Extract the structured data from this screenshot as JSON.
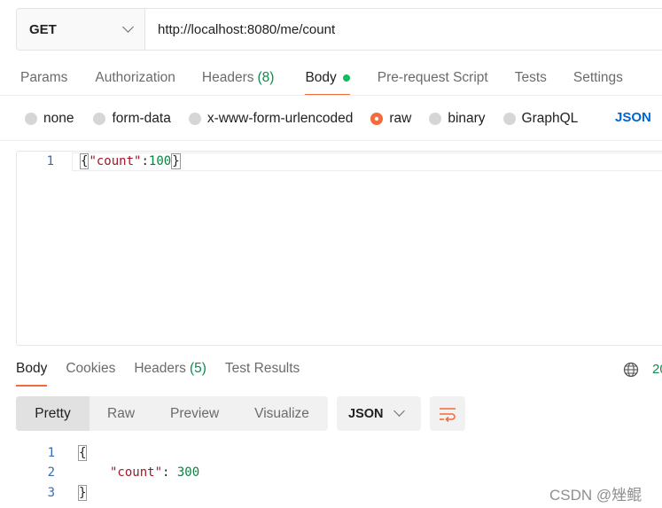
{
  "request": {
    "method": "GET",
    "url": "http://localhost:8080/me/count"
  },
  "request_tabs": [
    {
      "label": "Params"
    },
    {
      "label": "Authorization"
    },
    {
      "label": "Headers",
      "count": "(8)"
    },
    {
      "label": "Body",
      "active": true
    },
    {
      "label": "Pre-request Script"
    },
    {
      "label": "Tests"
    },
    {
      "label": "Settings"
    }
  ],
  "body_types": [
    "none",
    "form-data",
    "x-www-form-urlencoded",
    "raw",
    "binary",
    "GraphQL"
  ],
  "body_selected": "raw",
  "body_format": "JSON",
  "request_body": {
    "line": "1",
    "open_brace": "{",
    "key": "\"count\"",
    "colon": ":",
    "value": "100",
    "close_brace": "}"
  },
  "response_tabs": [
    {
      "label": "Body",
      "active": true
    },
    {
      "label": "Cookies"
    },
    {
      "label": "Headers",
      "count": "(5)"
    },
    {
      "label": "Test Results"
    }
  ],
  "response_status_clip": "20",
  "view_modes": [
    "Pretty",
    "Raw",
    "Preview",
    "Visualize"
  ],
  "response_format": "JSON",
  "response_body": {
    "lines": [
      "1",
      "2",
      "3"
    ],
    "open_brace": "{",
    "key": "\"count\"",
    "sep": ": ",
    "value": "300",
    "close_brace": "}"
  },
  "watermark": "CSDN @矬鲲",
  "colors": {
    "accent": "#f26b3a",
    "success": "#0f8a4f",
    "json_link": "#0265d2"
  }
}
